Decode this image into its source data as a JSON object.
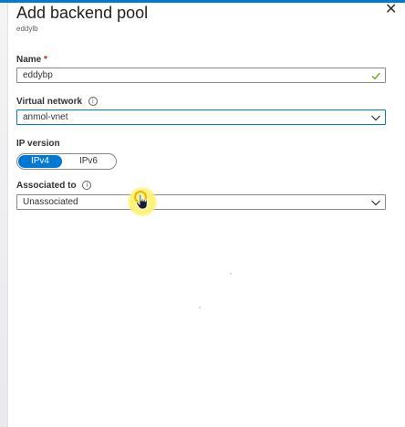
{
  "panel": {
    "title": "Add backend pool",
    "subtitle": "eddylb",
    "close_glyph": "✕"
  },
  "form": {
    "name": {
      "label": "Name",
      "required_marker": "*",
      "value": "eddybp"
    },
    "virtual_network": {
      "label": "Virtual network",
      "value": "anmol-vnet"
    },
    "ip_version": {
      "label": "IP version",
      "options": [
        "IPv4",
        "IPv6"
      ],
      "selected": "IPv4"
    },
    "associated_to": {
      "label": "Associated to",
      "value": "Unassociated"
    }
  },
  "icons": {
    "info": "info-icon",
    "checkmark": "checkmark-icon",
    "chevron": "chevron-down-icon",
    "cursor": "hand-pointer-icon"
  },
  "colors": {
    "accent": "#0078d4",
    "valid_check": "#57a300",
    "required": "#a4262c",
    "cursor_highlight": "#fff176"
  }
}
